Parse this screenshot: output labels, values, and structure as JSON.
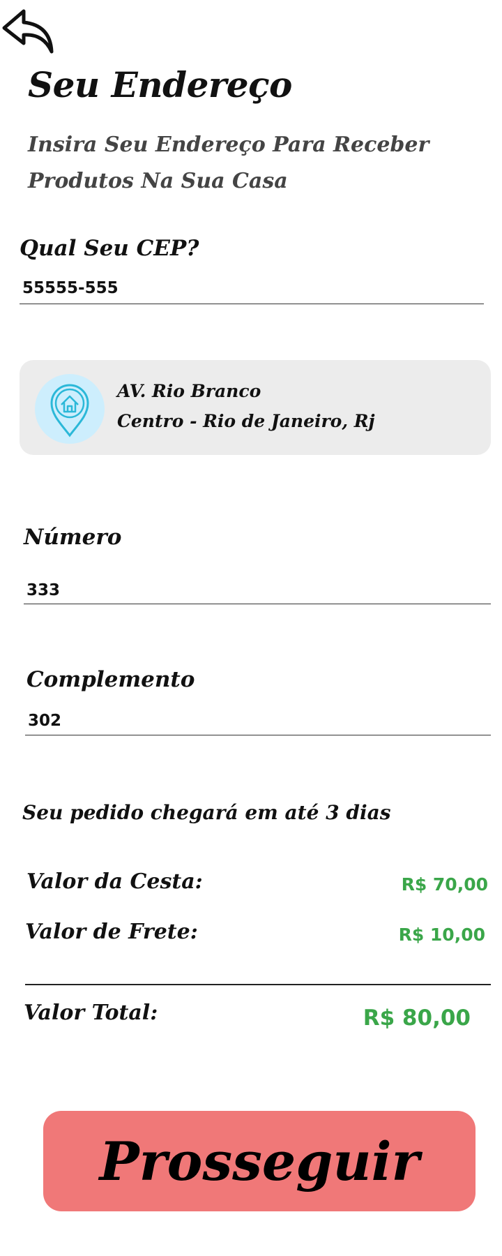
{
  "header": {
    "back_icon": "back-arrow-icon",
    "title": "Seu Endereço",
    "subtitle": "Insira Seu Endereço Para Receber Produtos Na Sua Casa"
  },
  "cep": {
    "label": "Qual Seu CEP?",
    "value": "55555-555"
  },
  "address_card": {
    "icon": "home-location-pin-icon",
    "line1": "AV. Rio Branco",
    "line2": "Centro - Rio de Janeiro, Rj"
  },
  "numero": {
    "label": "Número",
    "value": "333"
  },
  "complemento": {
    "label": "Complemento",
    "value": "302"
  },
  "delivery_text": "Seu pedido chegará em até 3 dias",
  "pricing": {
    "basket_label": "Valor da Cesta:",
    "basket_value": "R$ 70,00",
    "freight_label": "Valor de Frete:",
    "freight_value": "R$ 10,00",
    "total_label": "Valor Total:",
    "total_value": "R$ 80,00"
  },
  "proceed_label": "Prosseguir",
  "colors": {
    "price_green": "#3aa649",
    "button_bg": "#f07878",
    "card_bg": "#ececec",
    "pin_circle": "#cdeefd",
    "pin_icon": "#2bb8d8"
  }
}
